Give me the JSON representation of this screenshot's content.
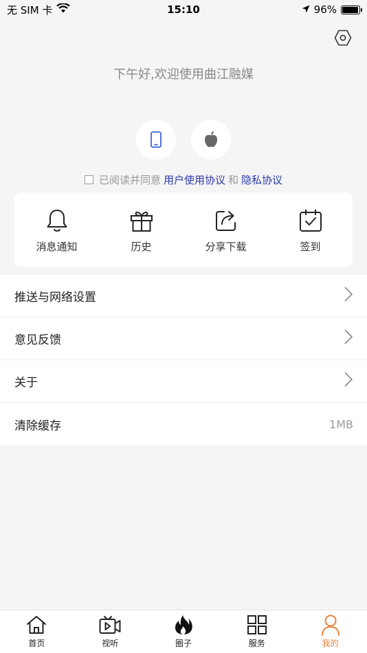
{
  "status_bar": {
    "carrier": "无 SIM 卡",
    "time": "15:10",
    "battery": "96%",
    "battery_level": 0.96
  },
  "header": {
    "greeting": "下午好,欢迎使用曲江融媒"
  },
  "login": {
    "phone_icon": "phone-icon",
    "apple_icon": "apple-icon"
  },
  "agreement": {
    "prefix": "已阅读并同意",
    "user_agreement": "用户使用协议",
    "and": "和",
    "privacy": "隐私协议"
  },
  "quick_actions": [
    {
      "label": "消息通知",
      "icon": "bell-icon"
    },
    {
      "label": "历史",
      "icon": "gift-icon"
    },
    {
      "label": "分享下载",
      "icon": "share-icon"
    },
    {
      "label": "签到",
      "icon": "calendar-check-icon"
    }
  ],
  "menu": [
    {
      "label": "推送与网络设置",
      "value": ""
    },
    {
      "label": "意见反馈",
      "value": ""
    },
    {
      "label": "关于",
      "value": ""
    },
    {
      "label": "清除缓存",
      "value": "1MB"
    }
  ],
  "tabs": [
    {
      "label": "首页",
      "icon": "home-icon"
    },
    {
      "label": "视听",
      "icon": "video-icon"
    },
    {
      "label": "圈子",
      "icon": "flame-icon"
    },
    {
      "label": "服务",
      "icon": "grid-icon"
    },
    {
      "label": "我的",
      "icon": "user-icon",
      "active": true
    }
  ],
  "colors": {
    "accent": "#e8823a",
    "link": "#2b3aa8",
    "phone_icon": "#3d63d6"
  }
}
